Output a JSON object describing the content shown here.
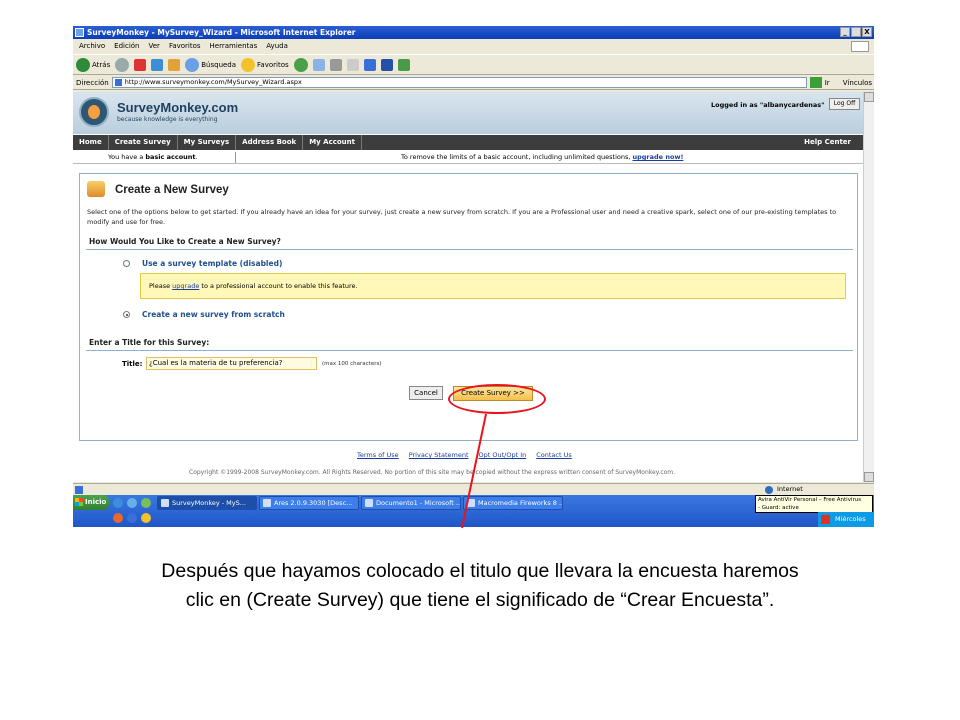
{
  "window": {
    "title": "SurveyMonkey - MySurvey_Wizard - Microsoft Internet Explorer",
    "min": "_",
    "max": " ",
    "close": "X"
  },
  "menu": [
    "Archivo",
    "Edición",
    "Ver",
    "Favoritos",
    "Herramientas",
    "Ayuda"
  ],
  "toolbar": {
    "back": "Atrás",
    "search": "Búsqueda",
    "favorites": "Favoritos"
  },
  "address": {
    "label": "Dirección",
    "url": "http://www.surveymonkey.com/MySurvey_Wizard.aspx",
    "go": "Ir",
    "links": "Vínculos"
  },
  "header": {
    "brand": "SurveyMonkey.com",
    "tagline": "because knowledge is everything",
    "logged_in": "Logged in as \"albanycardenas\"",
    "logoff": "Log Off"
  },
  "nav": {
    "items": [
      "Home",
      "Create Survey",
      "My Surveys",
      "Address Book",
      "My Account"
    ],
    "help": "Help Center"
  },
  "account": {
    "left_prefix": "You have a ",
    "left_bold": "basic account",
    "left_suffix": ".",
    "right_text": "To remove the limits of a basic account, including unlimited questions, ",
    "right_link": "upgrade now!"
  },
  "main": {
    "title": "Create a New Survey",
    "intro": "Select one of the options below to get started. If you already have an idea for your survey, just create a new survey from scratch. If you are a Professional user and need a creative spark, select one of our pre-existing templates to modify and use for free.",
    "how_heading": "How Would You Like to Create a New Survey?",
    "option_template": "Use a survey template (disabled)",
    "note_prefix": "Please ",
    "note_link": "upgrade",
    "note_suffix": " to a professional account to enable this feature.",
    "option_scratch": "Create a new survey from scratch",
    "title_heading": "Enter a Title for this Survey:",
    "title_label": "Title:",
    "title_value": "¿Cual es la materia de tu preferencia?",
    "max_chars": "(max 100 characters)",
    "cancel": "Cancel",
    "create": "Create Survey >>"
  },
  "footer": {
    "links": [
      "Terms of Use",
      "Privacy Statement",
      "Opt Out/Opt In",
      "Contact Us"
    ],
    "copyright": "Copyright ©1999-2008 SurveyMonkey.com.  All Rights Reserved.  No portion of this site may be copied without the express written consent of SurveyMonkey.com."
  },
  "status": {
    "zone": "Internet"
  },
  "taskbar": {
    "start": "Inicio",
    "buttons": [
      "SurveyMonkey - MyS...",
      "Ares 2.0.9.3030  [Desc...",
      "Documento1 - Microsoft ...",
      "Macromedia Fireworks 8 ..."
    ],
    "tooltip_line1": "Avira AntiVir Personal – Free Antivirus",
    "tooltip_line2": "- Guard: active",
    "clock": "Miércoles"
  },
  "caption": {
    "line1": "Después que hayamos colocado el titulo que llevara la encuesta haremos",
    "line2": "clic en (Create Survey) que tiene el significado de “Crear Encuesta”."
  },
  "colors": {
    "highlight": "#e8141e",
    "nav_bg": "#3d3d3d",
    "link": "#1a3c9e"
  }
}
